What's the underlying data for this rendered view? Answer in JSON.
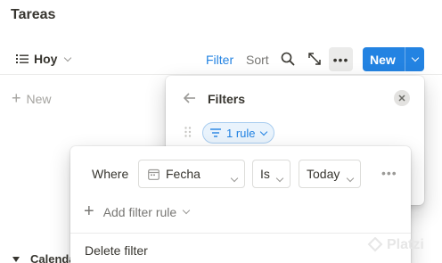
{
  "page": {
    "title": "Tareas"
  },
  "viewbar": {
    "view_name": "Hoy",
    "filter_label": "Filter",
    "sort_label": "Sort",
    "more_label": "•••",
    "new_label": "New"
  },
  "board": {
    "new_row_label": "New",
    "group_label": "Calendar"
  },
  "filters_popover": {
    "title": "Filters",
    "rule_chip_label": "1 rule"
  },
  "rule_panel": {
    "where_label": "Where",
    "field_value": "Fecha",
    "operator_value": "Is",
    "value_value": "Today",
    "more_label": "•••",
    "add_rule_label": "Add filter rule",
    "delete_label": "Delete filter"
  },
  "watermark": {
    "text": "Platzi"
  },
  "colors": {
    "accent": "#2383e2",
    "text": "#37352f",
    "muted": "#787774",
    "chip_bg": "#e9f3fc"
  }
}
